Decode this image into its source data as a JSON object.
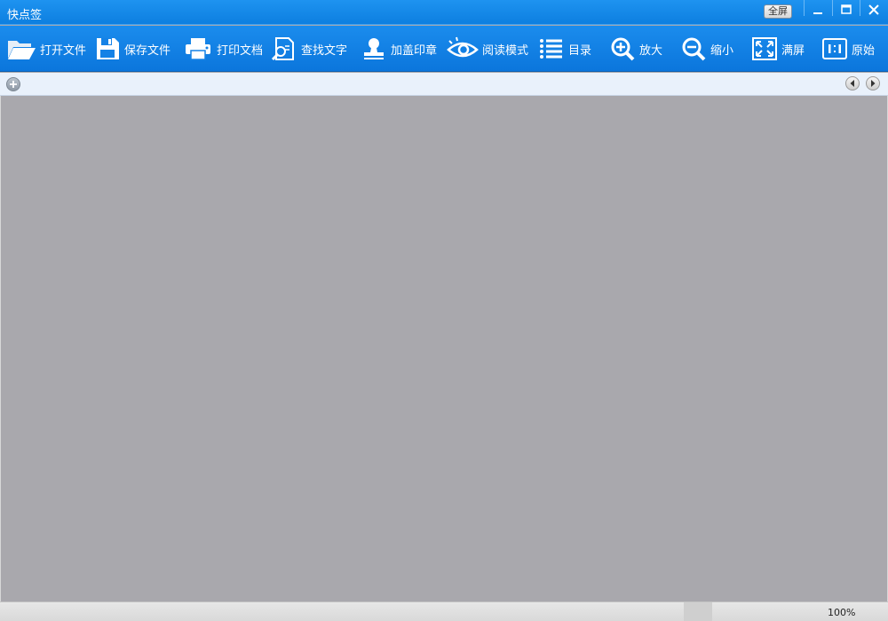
{
  "window": {
    "title": "快点签",
    "fullscreen_label": "全屏"
  },
  "toolbar": {
    "open_file": "打开文件",
    "save_file": "保存文件",
    "print_doc": "打印文档",
    "find_text": "查找文字",
    "add_stamp": "加盖印章",
    "reading_mode": "阅读模式",
    "toc": "目录",
    "zoom_in": "放大",
    "zoom_out": "缩小",
    "fit_screen": "满屏",
    "original": "原始"
  },
  "status": {
    "zoom": "100%"
  },
  "colors": {
    "title_bar": "#1e93f0",
    "toolbar": "#0b76dc",
    "canvas": "#a9a8ad"
  }
}
